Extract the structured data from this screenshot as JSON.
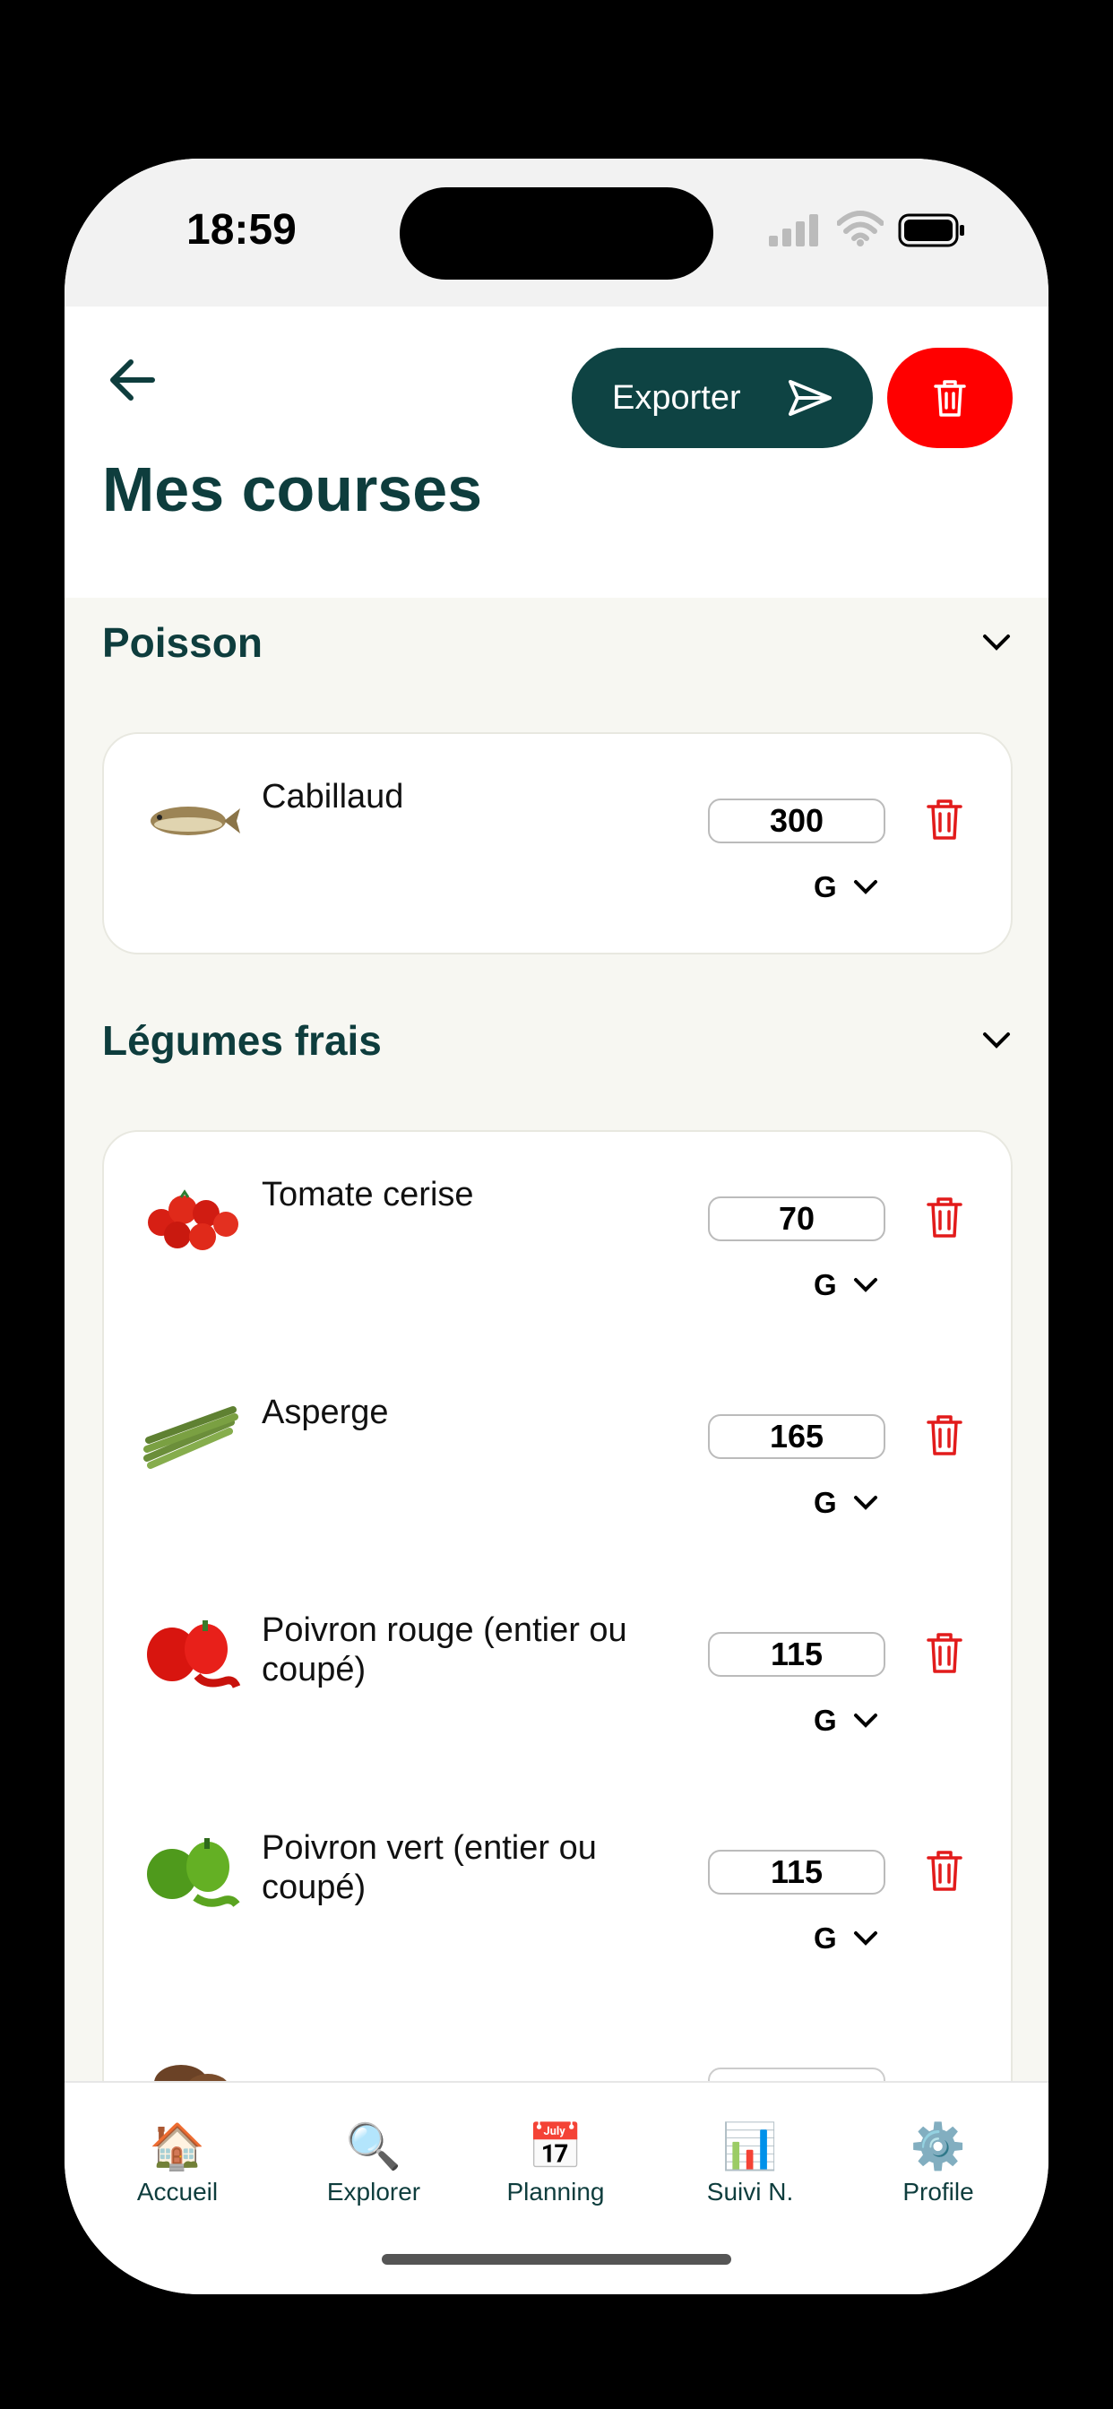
{
  "status": {
    "time": "18:59"
  },
  "header": {
    "export_label": "Exporter",
    "title": "Mes courses"
  },
  "sections": [
    {
      "name": "Poisson",
      "items": [
        {
          "name": "Cabillaud",
          "qty": "300",
          "unit": "G"
        }
      ]
    },
    {
      "name": "Légumes frais",
      "items": [
        {
          "name": "Tomate cerise",
          "qty": "70",
          "unit": "G"
        },
        {
          "name": "Asperge",
          "qty": "165",
          "unit": "G"
        },
        {
          "name": "Poivron rouge (entier ou coupé)",
          "qty": "115",
          "unit": "G"
        },
        {
          "name": "Poivron vert (entier ou coupé)",
          "qty": "115",
          "unit": "G"
        }
      ]
    }
  ],
  "nav": [
    {
      "label": "Accueil",
      "icon": "house-icon"
    },
    {
      "label": "Explorer",
      "icon": "magnifier-icon"
    },
    {
      "label": "Planning",
      "icon": "calendar-icon"
    },
    {
      "label": "Suivi N.",
      "icon": "bar-chart-icon"
    },
    {
      "label": "Profile",
      "icon": "gear-icon"
    }
  ],
  "colors": {
    "brand": "#0e4343",
    "danger": "#ff0000",
    "trash": "#e21b1b"
  }
}
